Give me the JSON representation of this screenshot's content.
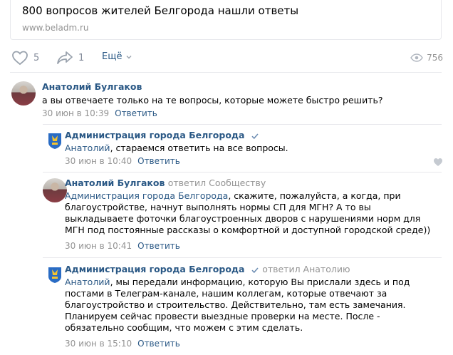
{
  "link_card": {
    "title": "800 вопросов жителей Белгорода нашли ответы",
    "domain": "www.beladm.ru"
  },
  "actions": {
    "likes": "5",
    "shares": "1",
    "more_label": "Ещё",
    "views": "756"
  },
  "comments": [
    {
      "author": "Анатолий Булгаков",
      "replied": "",
      "mention": "",
      "text": "а вы отвечаете только на те вопросы, которые можете быстро решить?",
      "time": "30 июн в 10:39",
      "reply_label": "Ответить"
    },
    {
      "author": "Администрация города Белгорода",
      "replied": "",
      "mention": "Анатолий",
      "text": ", стараемся ответить на все вопросы.",
      "time": "30 июн в 10:40",
      "reply_label": "Ответить"
    },
    {
      "author": "Анатолий Булгаков",
      "replied": "ответил Сообществу",
      "mention": "Администрация города Белгорода",
      "text": ", скажите, пожалуйста, а когда, при благоустройстве, начнут выполнять нормы СП для МГН? А то вы выкладываете фоточки благоустроенных дворов с нарушениями норм для МГН под постоянные рассказы о комфортной и доступной городской среде))",
      "time": "30 июн в 10:41",
      "reply_label": "Ответить"
    },
    {
      "author": "Администрация города Белгорода",
      "replied": "ответил Анатолию",
      "mention": "Анатолий",
      "text": ", мы передали информацию, которую Вы прислали здесь и под постами в Телеграм-канале, нашим коллегам, которые отвечают за благоустройство и строительство. Действительно, там есть замечания. Планируем сейчас провести выездные проверки на месте. После - обязательно сообщим, что можем с этим сделать.",
      "time": "30 июн в 15:10",
      "reply_label": "Ответить"
    }
  ]
}
